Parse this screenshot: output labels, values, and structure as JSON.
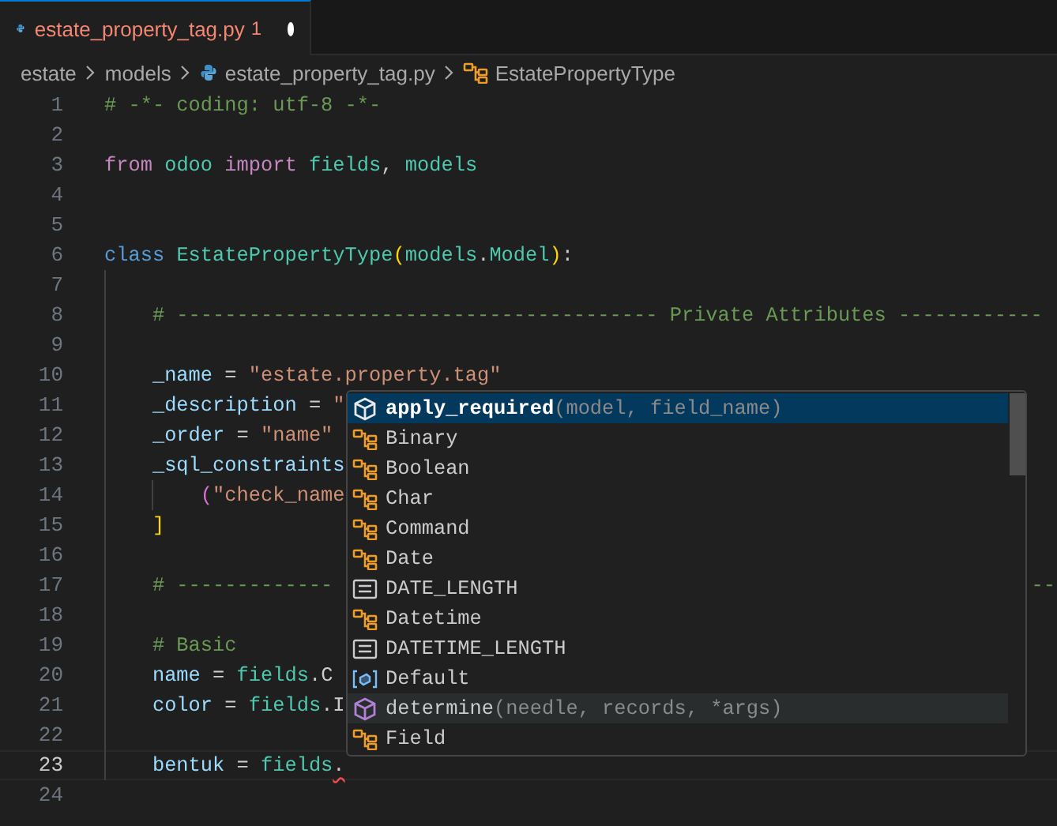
{
  "tab": {
    "filename": "estate_property_tag.py",
    "problems": "1",
    "dirty": true,
    "selected": true
  },
  "breadcrumbs": [
    {
      "label": "estate",
      "kind": "folder"
    },
    {
      "label": "models",
      "kind": "folder"
    },
    {
      "label": "estate_property_tag.py",
      "kind": "file"
    },
    {
      "label": "EstatePropertyType",
      "kind": "class"
    }
  ],
  "lines": [
    {
      "number": "1",
      "active": false,
      "tokens": [
        {
          "text": "# -*- coding: utf-8 -*-",
          "kind": "comment"
        }
      ]
    },
    {
      "number": "2",
      "active": false
    },
    {
      "number": "3",
      "active": false,
      "tokens": [
        {
          "text": "from ",
          "kind": "keyword"
        },
        {
          "text": "odoo ",
          "kind": "type"
        },
        {
          "text": "import ",
          "kind": "keyword"
        },
        {
          "text": "fields",
          "kind": "type"
        },
        {
          "text": ", ",
          "kind": "plain"
        },
        {
          "text": "models",
          "kind": "type"
        }
      ]
    },
    {
      "number": "4",
      "active": false
    },
    {
      "number": "5",
      "active": false
    },
    {
      "number": "6",
      "active": false,
      "tokens": [
        {
          "text": "class ",
          "kind": "storage"
        },
        {
          "text": "EstatePropertyType",
          "kind": "type"
        },
        {
          "text": "(",
          "kind": "brace"
        },
        {
          "text": "models",
          "kind": "type"
        },
        {
          "text": ".",
          "kind": "plain"
        },
        {
          "text": "Model",
          "kind": "type"
        },
        {
          "text": ")",
          "kind": "brace"
        },
        {
          "text": ":",
          "kind": "plain"
        }
      ]
    },
    {
      "number": "7",
      "active": false
    },
    {
      "number": "8",
      "active": false,
      "tokens": [
        {
          "text": "    # ---------------------------------------- Private Attributes ------------",
          "kind": "comment"
        }
      ]
    },
    {
      "number": "9",
      "active": false
    },
    {
      "number": "10",
      "active": false,
      "tokens": [
        {
          "text": "    _name",
          "kind": "variable"
        },
        {
          "text": " = ",
          "kind": "plain"
        },
        {
          "text": "\"estate.property.tag\"",
          "kind": "string"
        }
      ]
    },
    {
      "number": "11",
      "active": false,
      "tokens": [
        {
          "text": "    _description",
          "kind": "variable"
        },
        {
          "text": " = ",
          "kind": "plain"
        },
        {
          "text": "\"",
          "kind": "string"
        }
      ]
    },
    {
      "number": "12",
      "active": false,
      "tokens": [
        {
          "text": "    _order",
          "kind": "variable"
        },
        {
          "text": " = ",
          "kind": "plain"
        },
        {
          "text": "\"name\"",
          "kind": "string"
        }
      ]
    },
    {
      "number": "13",
      "active": false,
      "tokens": [
        {
          "text": "    _sql_constraints",
          "kind": "variable"
        }
      ]
    },
    {
      "number": "14",
      "active": false,
      "tokens": [
        {
          "text": "        (",
          "kind": "bracket"
        },
        {
          "text": "\"check_name",
          "kind": "string"
        }
      ]
    },
    {
      "number": "15",
      "active": false,
      "tokens": [
        {
          "text": "    ]",
          "kind": "brace"
        }
      ]
    },
    {
      "number": "16",
      "active": false
    },
    {
      "number": "17",
      "active": false,
      "tokens": [
        {
          "text": "    # -------------",
          "kind": "comment"
        }
      ],
      "tail": {
        "text": "--",
        "kind": "comment"
      }
    },
    {
      "number": "18",
      "active": false
    },
    {
      "number": "19",
      "active": false,
      "tokens": [
        {
          "text": "    # Basic",
          "kind": "comment"
        }
      ]
    },
    {
      "number": "20",
      "active": false,
      "tokens": [
        {
          "text": "    name",
          "kind": "variable"
        },
        {
          "text": " = ",
          "kind": "plain"
        },
        {
          "text": "fields",
          "kind": "type"
        },
        {
          "text": ".C",
          "kind": "plain"
        }
      ]
    },
    {
      "number": "21",
      "active": false,
      "tokens": [
        {
          "text": "    color",
          "kind": "variable"
        },
        {
          "text": " = ",
          "kind": "plain"
        },
        {
          "text": "fields",
          "kind": "type"
        },
        {
          "text": ".I",
          "kind": "plain"
        }
      ]
    },
    {
      "number": "22",
      "active": false
    },
    {
      "number": "23",
      "active": true,
      "tokens": [
        {
          "text": "    bentuk",
          "kind": "variable"
        },
        {
          "text": " = ",
          "kind": "plain"
        },
        {
          "text": "fields",
          "kind": "type"
        },
        {
          "text": ".",
          "kind": "error"
        }
      ]
    },
    {
      "number": "24",
      "active": false
    }
  ],
  "suggestions": [
    {
      "label": "apply_required",
      "detail": "(model, field_name)",
      "kind": "method",
      "selected": true,
      "hovered": false
    },
    {
      "label": "Binary",
      "kind": "class",
      "selected": false,
      "hovered": false
    },
    {
      "label": "Boolean",
      "kind": "class",
      "selected": false,
      "hovered": false
    },
    {
      "label": "Char",
      "kind": "class",
      "selected": false,
      "hovered": false
    },
    {
      "label": "Command",
      "kind": "class",
      "selected": false,
      "hovered": false
    },
    {
      "label": "Date",
      "kind": "class",
      "selected": false,
      "hovered": false
    },
    {
      "label": "DATE_LENGTH",
      "kind": "constant",
      "selected": false,
      "hovered": false
    },
    {
      "label": "Datetime",
      "kind": "class",
      "selected": false,
      "hovered": false
    },
    {
      "label": "DATETIME_LENGTH",
      "kind": "constant",
      "selected": false,
      "hovered": false
    },
    {
      "label": "Default",
      "kind": "variable",
      "selected": false,
      "hovered": false
    },
    {
      "label": "determine",
      "detail": "(needle, records, *args)",
      "kind": "function",
      "selected": false,
      "hovered": true
    },
    {
      "label": "Field",
      "kind": "class",
      "selected": false,
      "hovered": false
    }
  ]
}
